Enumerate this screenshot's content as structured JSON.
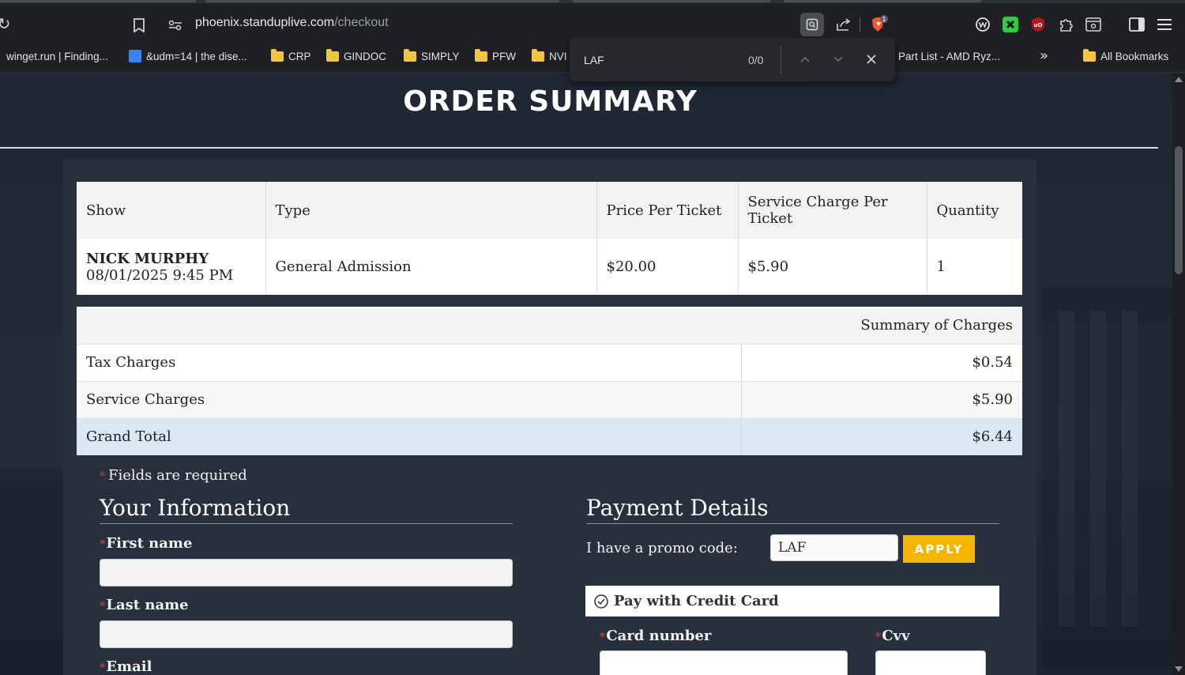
{
  "browser": {
    "url_host": "phoenix.standuplive.com",
    "url_path": "/checkout",
    "bookmarks": [
      {
        "label": "winget.run | Finding..."
      },
      {
        "label": "&udm=14 | the dise..."
      },
      {
        "label": "CRP"
      },
      {
        "label": "GINDOC"
      },
      {
        "label": "SIMPLY"
      },
      {
        "label": "PFW"
      },
      {
        "label": "NVI"
      },
      {
        "label": "Part List - AMD Ryz..."
      }
    ],
    "all_bookmarks_label": "All Bookmarks",
    "brave_badge": "1",
    "find": {
      "query": "LAF",
      "count": "0/0"
    }
  },
  "page": {
    "title": "ORDER SUMMARY",
    "tickets": {
      "headers": [
        "Show",
        "Type",
        "Price Per Ticket",
        "Service Charge Per Ticket",
        "Quantity"
      ],
      "row": {
        "show_name": "NICK MURPHY",
        "show_datetime": "08/01/2025 9:45 PM",
        "type": "General Admission",
        "price": "$20.00",
        "service_charge": "$5.90",
        "quantity": "1"
      }
    },
    "charges": {
      "header": "Summary of Charges",
      "rows": [
        {
          "label": "Tax Charges",
          "amount": "$0.54"
        },
        {
          "label": "Service Charges",
          "amount": "$5.90"
        },
        {
          "label": "Grand Total",
          "amount": "$6.44"
        }
      ]
    },
    "required_note": "Fields are required",
    "your_info": {
      "title": "Your Information",
      "first_name_label": "First name",
      "last_name_label": "Last name",
      "email_label": "Email"
    },
    "payment": {
      "title": "Payment Details",
      "promo_label": "I have a promo code:",
      "promo_value": "LAF",
      "apply_label": "APPLY",
      "pay_with_card_label": "Pay with Credit Card",
      "card_number_label": "Card number",
      "cvv_label": "Cvv"
    }
  }
}
